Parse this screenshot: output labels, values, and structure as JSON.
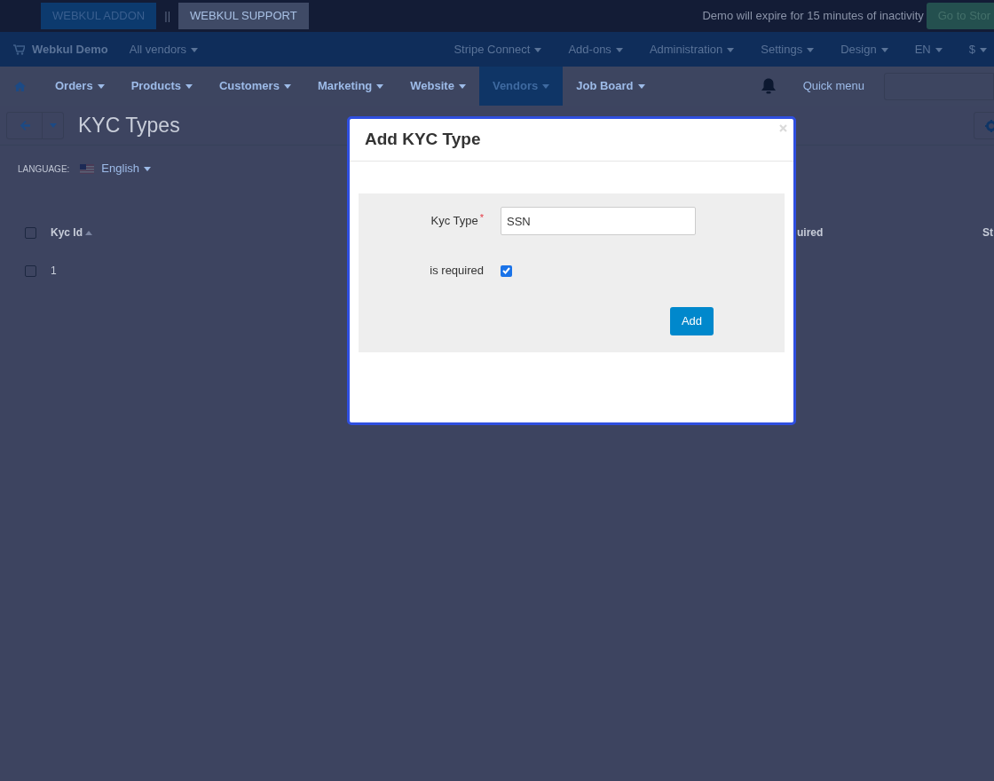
{
  "top_bar": {
    "buttons": [
      {
        "label": "WEBKUL ADDON",
        "selected": true
      },
      {
        "label": "WEBKUL SUPPORT",
        "selected": false
      }
    ],
    "separator": "||",
    "notice": "Demo will expire for 15 minutes of inactivity",
    "store_button": "Go to Stor"
  },
  "header": {
    "shop": "Webkul Demo",
    "vendor_select": "All vendors",
    "menus": [
      "Stripe Connect",
      "Add-ons",
      "Administration",
      "Settings",
      "Design",
      "EN",
      "$"
    ]
  },
  "nav": {
    "items": [
      {
        "label": "Orders",
        "selected": false
      },
      {
        "label": "Products",
        "selected": false
      },
      {
        "label": "Customers",
        "selected": false
      },
      {
        "label": "Marketing",
        "selected": false
      },
      {
        "label": "Website",
        "selected": false
      },
      {
        "label": "Vendors",
        "selected": true
      },
      {
        "label": "Job Board",
        "selected": false
      }
    ],
    "quick_menu": "Quick menu"
  },
  "page": {
    "title": "KYC Types",
    "language_label": "LANGUAGE:",
    "language": "English"
  },
  "table": {
    "select_all_checked": false,
    "columns": [
      {
        "label": "Kyc Id",
        "sorted": true
      },
      {
        "label": "uired",
        "sorted": false
      },
      {
        "label": "St",
        "sorted": false
      }
    ],
    "rows": [
      {
        "cells": [
          "1"
        ],
        "checked": false
      }
    ]
  },
  "modal": {
    "title": "Add KYC Type",
    "fields": [
      {
        "kind": "text",
        "label": "Kyc Type",
        "required_mark": "*",
        "value": "SSN"
      },
      {
        "kind": "checkbox",
        "label": "is required",
        "checked": true
      }
    ],
    "submit": "Add"
  }
}
